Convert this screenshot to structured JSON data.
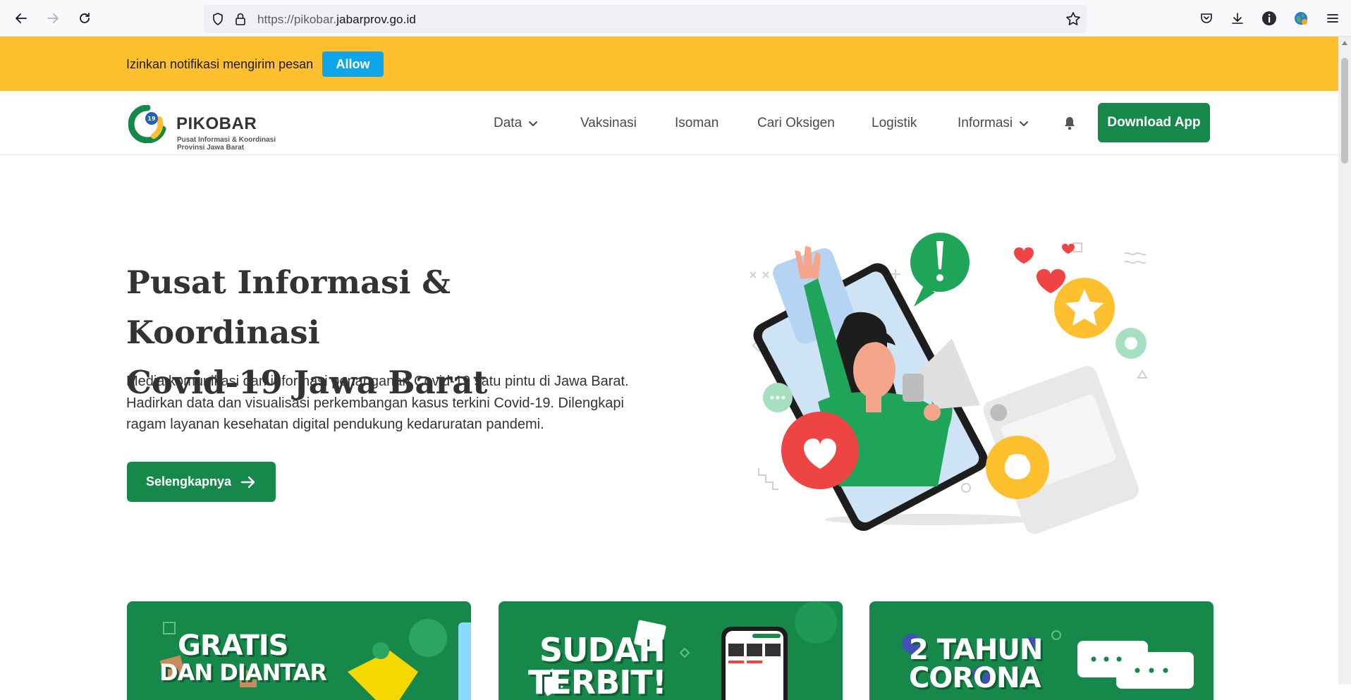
{
  "browser": {
    "url_dim": "https://pikobar.",
    "url_domain": "jabarprov.go.id"
  },
  "notification": {
    "message": "Izinkan notifikasi mengirim pesan",
    "allow_label": "Allow"
  },
  "header": {
    "logo_name": "PIKOBAR",
    "logo_tagline_1": "Pusat Informasi & Koordinasi",
    "logo_tagline_2": "Provinsi Jawa Barat",
    "nav": [
      {
        "label": "Data",
        "dropdown": true
      },
      {
        "label": "Vaksinasi",
        "dropdown": false
      },
      {
        "label": "Isoman",
        "dropdown": false
      },
      {
        "label": "Cari Oksigen",
        "dropdown": false
      },
      {
        "label": "Logistik",
        "dropdown": false
      },
      {
        "label": "Informasi",
        "dropdown": true
      }
    ],
    "download_label": "Download App"
  },
  "hero": {
    "title_line1": "Pusat Informasi & Koordinasi",
    "title_line2": "Covid-19 Jawa Barat",
    "description_line1": "Media komunikasi dan informasi penanganan Covid-19 satu pintu di Jawa Barat.",
    "description_line2": "Hadirkan data dan visualisasi perkembangan kasus terkini Covid-19. Dilengkapi",
    "description_line3": "ragam layanan kesehatan digital pendukung kedaruratan pandemi.",
    "cta_label": "Selengkapnya"
  },
  "cards": [
    {
      "line1": "GRATIS",
      "line2": "DAN DIANTAR"
    },
    {
      "line1": "SUDAH",
      "line2": "TERBIT!"
    },
    {
      "line1": "2 TAHUN",
      "line2": "CORONA"
    }
  ],
  "colors": {
    "brand_green": "#16894a",
    "banner_yellow": "#fec02f",
    "allow_blue": "#0ea5e9"
  }
}
